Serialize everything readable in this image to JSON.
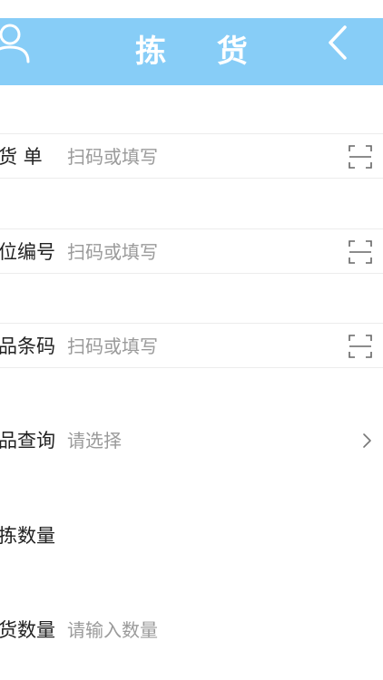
{
  "header": {
    "title": "拣 货",
    "left_icon": "user-icon",
    "right_icon": "back-chevron-icon"
  },
  "colors": {
    "header_bg": "#87cdf7",
    "header_text": "#ffffff",
    "placeholder": "#9a9a9a",
    "label": "#222222"
  },
  "form": {
    "rows": [
      {
        "label": "货 单",
        "placeholder": "扫码或填写",
        "icon": "scan-icon"
      },
      {
        "label": "位编号",
        "placeholder": "扫码或填写",
        "icon": "scan-icon"
      },
      {
        "label": "品条码",
        "placeholder": "扫码或填写",
        "icon": "scan-icon"
      },
      {
        "label": "品查询",
        "placeholder": "请选择",
        "icon": "chevron-right-icon"
      },
      {
        "label": "拣数量",
        "placeholder": "",
        "icon": ""
      },
      {
        "label": "货数量",
        "placeholder": "请输入数量",
        "icon": ""
      }
    ]
  }
}
